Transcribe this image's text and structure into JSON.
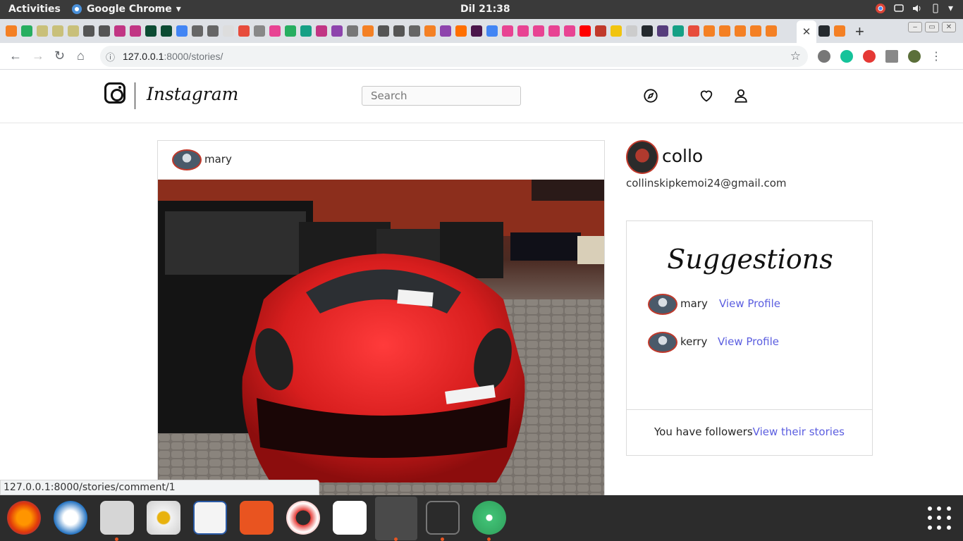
{
  "gnome": {
    "activities": "Activities",
    "app_name": "Google Chrome",
    "clock": "Dil 21:38"
  },
  "browser": {
    "url_host": "127.0.0.1",
    "url_path": ":8000/stories/",
    "status_url": "127.0.0.1:8000/stories/comment/1"
  },
  "ig": {
    "brand": "Instagram",
    "search_placeholder": "Search"
  },
  "post": {
    "username": "mary",
    "image": "red-sports-car-photo"
  },
  "profile": {
    "name": "collo",
    "email": "collinskipkemoi24@gmail.com"
  },
  "suggestions": {
    "title": "Suggestions",
    "items": [
      {
        "name": "mary",
        "link": "View Profile"
      },
      {
        "name": "kerry",
        "link": "View Profile"
      }
    ],
    "followers_text": "You have followers",
    "followers_link": "View their stories"
  },
  "colors": {
    "link": "#5b5ee0",
    "avatar_border": "#c0392b",
    "car_red": "#d81e1e"
  }
}
